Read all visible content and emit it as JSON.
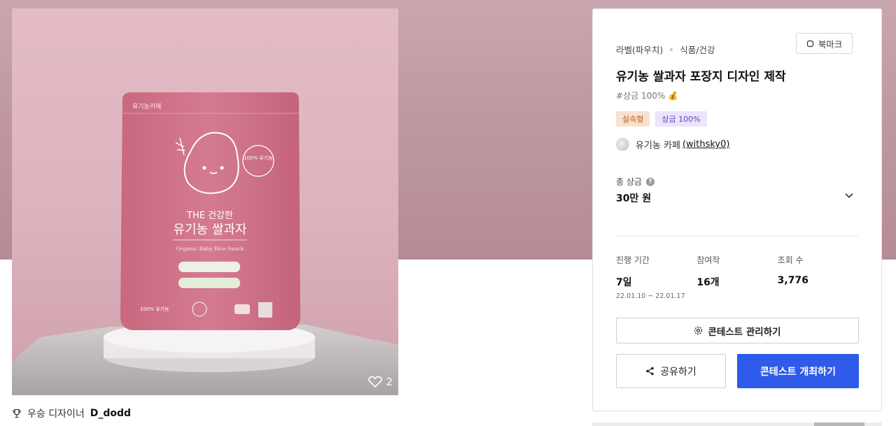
{
  "product": {
    "likes": "2",
    "package_text": {
      "brand": "유기농카페",
      "headline_small": "THE 건강한",
      "headline_large": "유기농 쌀과자",
      "english_sub": "Organic Baby Rice Snack",
      "seal": "100% 유기농",
      "info": "100% 유기농"
    }
  },
  "winner": {
    "label": "우승 디자이너",
    "name": "D_dodd"
  },
  "contest": {
    "category": "라벨(파우치)",
    "subcategory": "식품/건강",
    "bookmark_label": "북마크",
    "title": "유기농 쌀과자 포장지 디자인 제작",
    "tagline": "#상금 100%",
    "badges": {
      "type": "실속형",
      "prize": "상금 100%"
    },
    "host_name": "유기농 카페",
    "host_handle": "(withsky0)",
    "prize_label": "총 상금",
    "prize_value": "30만 원",
    "stats": {
      "period_label": "진행 기간",
      "period_value": "7일",
      "period_range": "22.01.10 ~ 22.01.17",
      "entries_label": "참여작",
      "entries_value": "16개",
      "views_label": "조회 수",
      "views_value": "3,776"
    },
    "manage_label": "콘테스트 관리하기",
    "share_label": "공유하기",
    "host_label": "콘테스트 개최하기"
  },
  "colors": {
    "accent": "#2f5bea",
    "hero_bg": "#bf98a2",
    "pouch": "#cf7388"
  }
}
